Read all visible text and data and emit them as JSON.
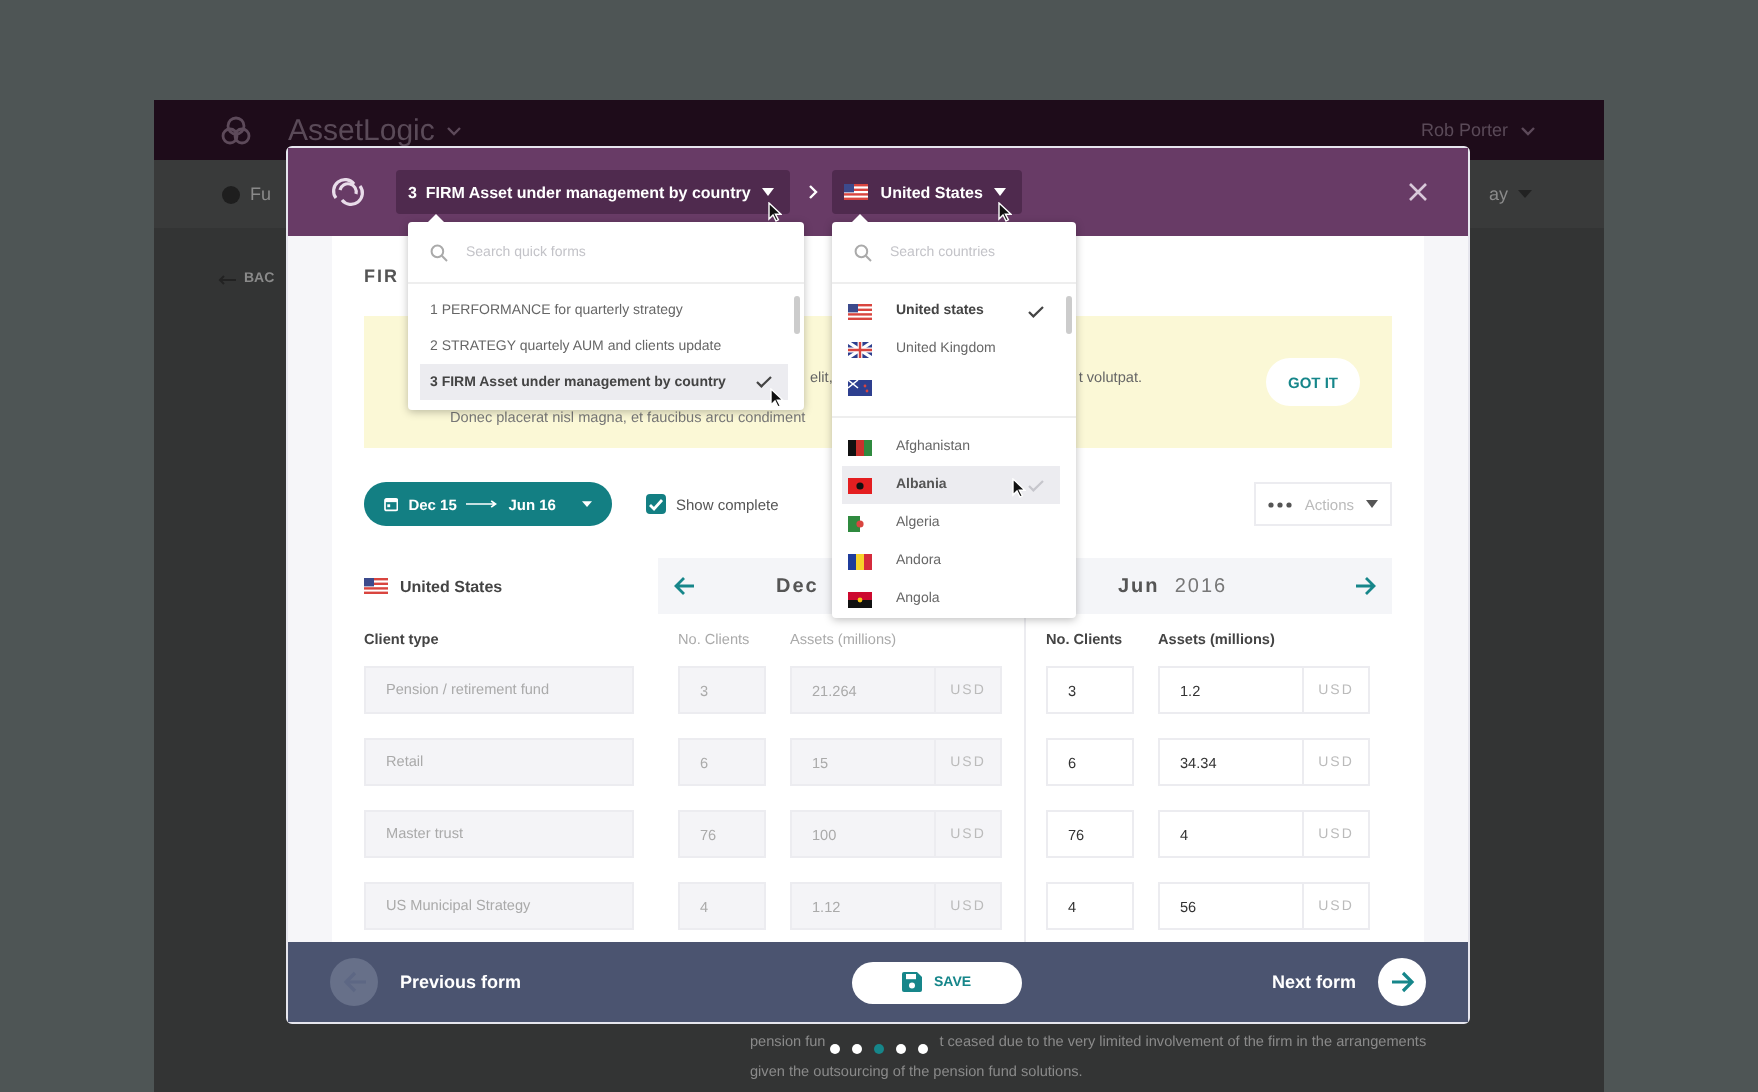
{
  "app": {
    "brand": "AssetLogic",
    "user": "Rob Porter",
    "nav_item": "Fu",
    "back_link": "BAC",
    "nav_right": "ay",
    "paragraph": [
      [
        "pension fun",
        "t ceased due to the very limited involvement of the firm in the arrangements"
      ],
      [
        "given the outsourcing of the pension fund solutions."
      ]
    ]
  },
  "modal": {
    "form_picker": {
      "label": "3  FIRM Asset under management by country"
    },
    "country_picker": {
      "kind": "us",
      "label": "United States"
    },
    "title": "FIR",
    "notice": {
      "fragments": [
        "elit,",
        "t volutpat."
      ],
      "second_line": "Donec placerat nisl magna, et faucibus arcu condiment",
      "button": "GOT IT"
    },
    "date_range": {
      "start": "Dec 15",
      "end": "Jun 16"
    },
    "show_complete": {
      "label": "Show complete",
      "checked": true
    },
    "actions": {
      "label": "Actions"
    },
    "table": {
      "country": {
        "kind": "us",
        "label": "United States"
      },
      "client_type_header": "Client type",
      "client_types": [
        "Pension / retirement fund",
        "Retail",
        "Master trust",
        "US Municipal Strategy"
      ],
      "periods": [
        {
          "kind": "previous",
          "month": "Dec",
          "editable": false,
          "columns": [
            "No. Clients",
            "Assets (millions)"
          ],
          "rows": [
            {
              "clients": "3",
              "assets": "21.264",
              "currency": "USD"
            },
            {
              "clients": "6",
              "assets": "15",
              "currency": "USD"
            },
            {
              "clients": "76",
              "assets": "100",
              "currency": "USD"
            },
            {
              "clients": "4",
              "assets": "1.12",
              "currency": "USD"
            }
          ]
        },
        {
          "kind": "next",
          "month": "Jun",
          "year": "2016",
          "editable": true,
          "columns": [
            "No. Clients",
            "Assets (millions)"
          ],
          "rows": [
            {
              "clients": "3",
              "assets": "1.2",
              "currency": "USD"
            },
            {
              "clients": "6",
              "assets": "34.34",
              "currency": "USD"
            },
            {
              "clients": "76",
              "assets": "4",
              "currency": "USD"
            },
            {
              "clients": "4",
              "assets": "56",
              "currency": "USD"
            }
          ]
        }
      ]
    },
    "footer": {
      "previous": "Previous form",
      "previous_enabled": false,
      "save": "SAVE",
      "next": "Next form",
      "next_enabled": true
    }
  },
  "quick_forms": {
    "placeholder": "Search quick forms",
    "items": [
      {
        "label": "1 PERFORMANCE for quarterly strategy",
        "selected": false
      },
      {
        "label": "2 STRATEGY quartely AUM and clients update",
        "selected": false
      },
      {
        "label": "3 FIRM Asset under management by country",
        "selected": true
      }
    ]
  },
  "countries": {
    "placeholder": "Search countries",
    "groups": [
      [
        {
          "kind": "us",
          "label": "United states",
          "selected": true,
          "highlighted": false
        },
        {
          "kind": "gb",
          "label": "United Kingdom",
          "selected": false,
          "highlighted": false
        },
        {
          "kind": "nz",
          "selected": false,
          "highlighted": false
        }
      ],
      [
        {
          "kind": "af",
          "label": "Afghanistan",
          "selected": false,
          "highlighted": false
        },
        {
          "kind": "al",
          "label": "Albania",
          "selected": false,
          "highlighted": true
        },
        {
          "kind": "dz",
          "label": "Algeria",
          "selected": false,
          "highlighted": false
        },
        {
          "kind": "ad",
          "label": "Andora",
          "selected": false,
          "highlighted": false
        },
        {
          "kind": "ao",
          "label": "Angola",
          "selected": false,
          "highlighted": false
        }
      ]
    ]
  },
  "pager": [
    {
      "selected": false
    },
    {
      "selected": false
    },
    {
      "selected": true
    },
    {
      "selected": false
    },
    {
      "selected": false
    }
  ]
}
